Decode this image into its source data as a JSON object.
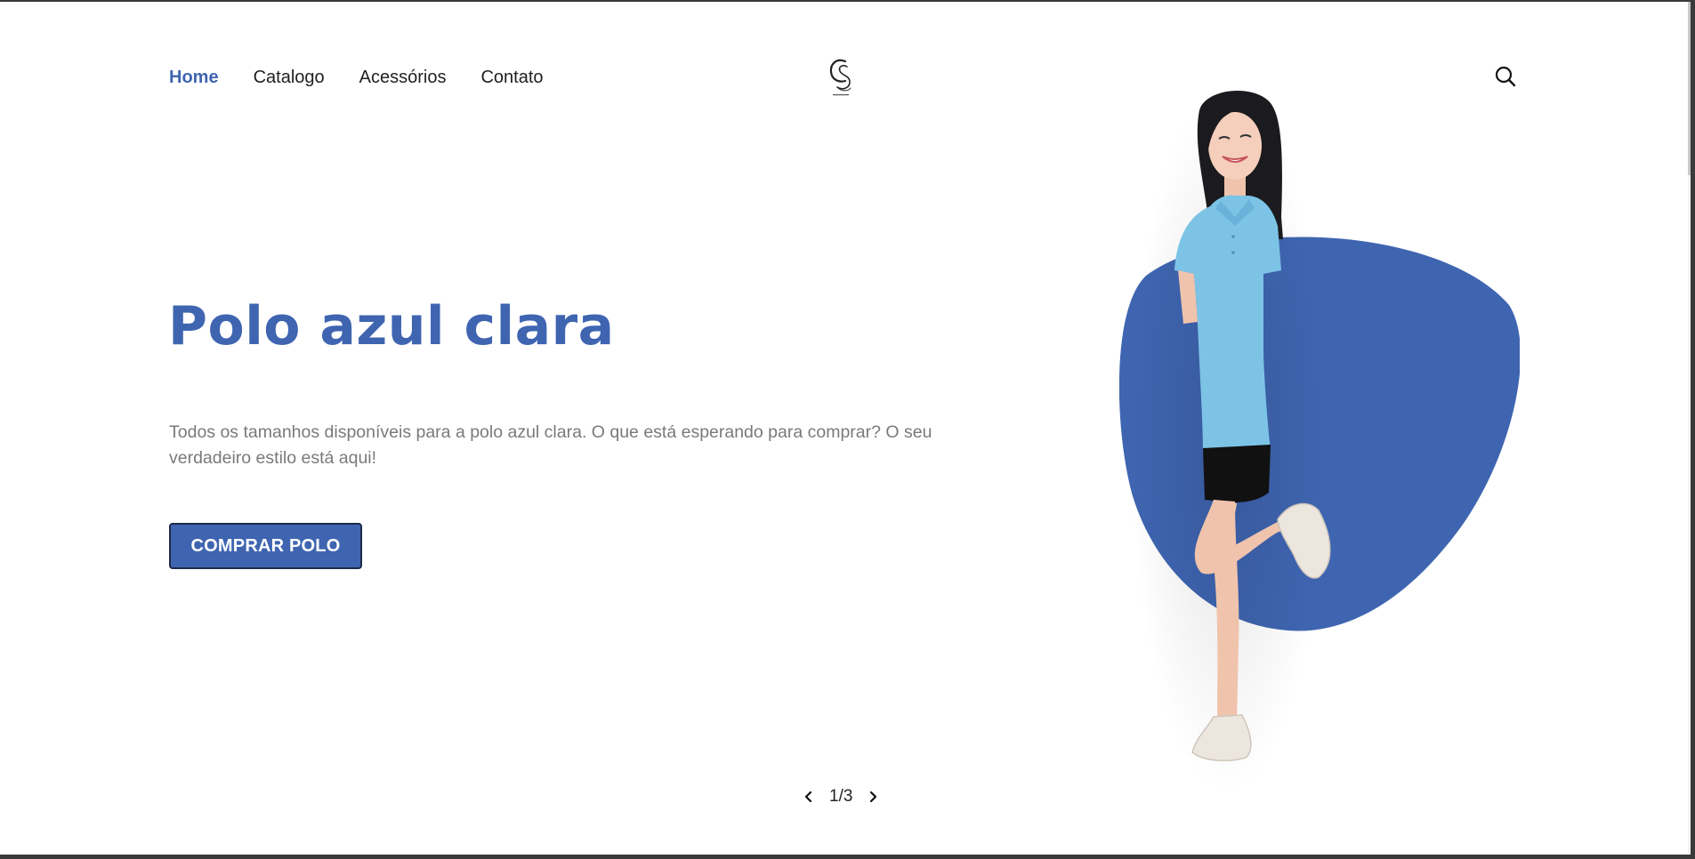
{
  "header": {
    "nav": [
      {
        "label": "Home",
        "active": true
      },
      {
        "label": "Catalogo",
        "active": false
      },
      {
        "label": "Acessórios",
        "active": false
      },
      {
        "label": "Contato",
        "active": false
      }
    ],
    "logo_icon": "cs-monogram-logo",
    "search_icon": "search-icon"
  },
  "hero": {
    "title": "Polo azul clara",
    "description": "Todos os tamanhos disponíveis para a polo azul clara. O que está esperando para comprar? O seu verdadeiro estilo está aqui!",
    "cta_label": "COMPRAR POLO"
  },
  "slider": {
    "counter": "1/3",
    "prev_icon": "chevron-left-icon",
    "next_icon": "chevron-right-icon"
  },
  "colors": {
    "accent": "#3f65b1",
    "text": "#1f1f1f",
    "muted": "#7a7a7a",
    "shirt": "#7cc3e6"
  }
}
